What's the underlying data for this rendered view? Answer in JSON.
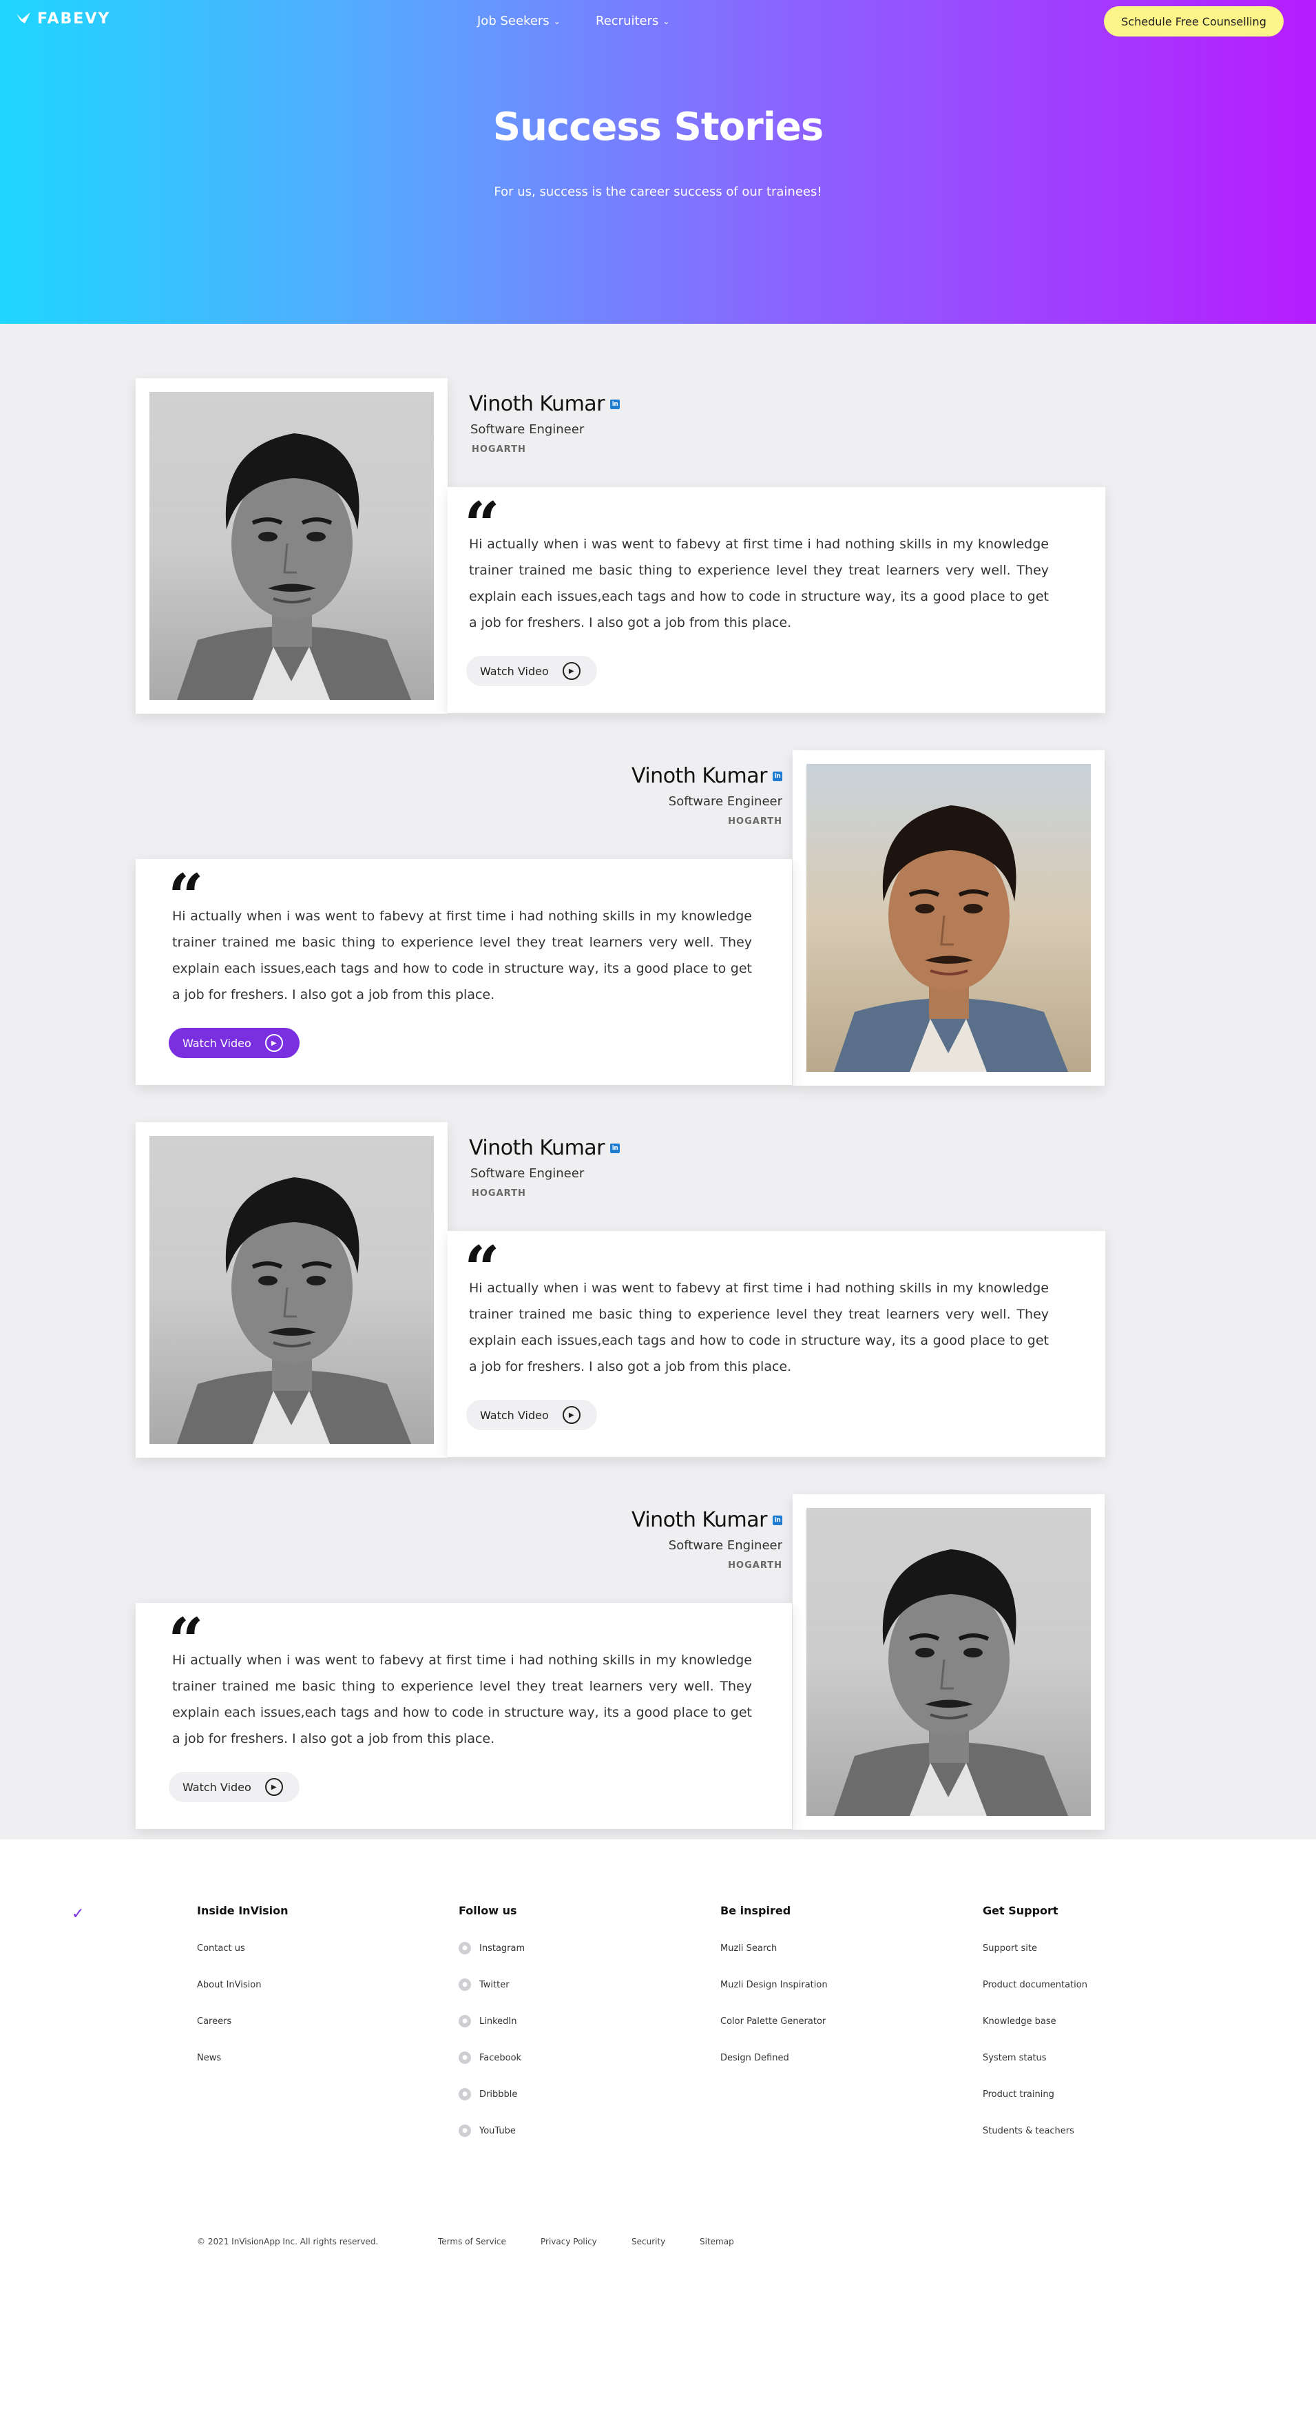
{
  "header": {
    "logo_text": "FABEVY",
    "nav": [
      {
        "label": "Job Seekers"
      },
      {
        "label": "Recruiters"
      }
    ],
    "cta_label": "Schedule Free Counselling"
  },
  "hero": {
    "title": "Success Stories",
    "subtitle": "For us, success is the career success of our trainees!"
  },
  "stories": [
    {
      "name": "Vinoth Kumar",
      "role": "Software Engineer",
      "company": "HOGARTH",
      "quote": "Hi actually when i was went to fabevy at first time i had nothing skills in my knowledge trainer trained me basic thing to experience level they treat learners very well. They explain each issues,each tags and how to code in structure way, its a good place to get a job for freshers. I also got a job from this place.",
      "button_label": "Watch Video",
      "button_active": false,
      "photo_grayscale": true
    },
    {
      "name": "Vinoth Kumar",
      "role": "Software Engineer",
      "company": "HOGARTH",
      "quote": "Hi actually when i was went to fabevy at first time i had nothing skills in my knowledge trainer trained me basic thing to experience level they treat learners very well. They explain each issues,each tags and how to code in structure way, its a good place to get a job for freshers. I also got a job from this place.",
      "button_label": "Watch Video",
      "button_active": true,
      "photo_grayscale": false
    },
    {
      "name": "Vinoth Kumar",
      "role": "Software Engineer",
      "company": "HOGARTH",
      "quote": "Hi actually when i was went to fabevy at first time i had nothing skills in my knowledge trainer trained me basic thing to experience level they treat learners very well. They explain each issues,each tags and how to code in structure way, its a good place to get a job for freshers. I also got a job from this place.",
      "button_label": "Watch Video",
      "button_active": false,
      "photo_grayscale": true
    },
    {
      "name": "Vinoth Kumar",
      "role": "Software Engineer",
      "company": "HOGARTH",
      "quote": "Hi actually when i was went to fabevy at first time i had nothing skills in my knowledge trainer trained me basic thing to experience level they treat learners very well. They explain each issues,each tags and how to code in structure way, its a good place to get a job for freshers. I also got a job from this place.",
      "button_label": "Watch Video",
      "button_active": false,
      "photo_grayscale": true
    }
  ],
  "footer": {
    "columns": [
      {
        "heading": "Inside InVision",
        "links": [
          "Contact us",
          "About InVision",
          "Careers",
          "News"
        ]
      },
      {
        "heading": "Follow us",
        "links": [
          "Instagram",
          "Twitter",
          "LinkedIn",
          "Facebook",
          "Dribbble",
          "YouTube"
        ]
      },
      {
        "heading": "Be inspired",
        "links": [
          "Muzli Search",
          "Muzli Design Inspiration",
          "Color Palette Generator",
          "Design Defined"
        ]
      },
      {
        "heading": "Get Support",
        "links": [
          "Support site",
          "Product documentation",
          "Knowledge base",
          "System status",
          "Product training",
          "Students & teachers"
        ]
      }
    ],
    "copyright": "© 2021 InVisionApp Inc. All rights reserved.",
    "legal_links": [
      "Terms of Service",
      "Privacy Policy",
      "Security",
      "Sitemap"
    ]
  },
  "colors": {
    "accent": "#7a2fe0",
    "cta_bg": "#fdf48a",
    "linkedin": "#1f7dd1"
  },
  "icons": [
    "fabevy-logo-icon",
    "chevron-down-icon",
    "linkedin-icon",
    "quote-icon",
    "play-icon",
    "instagram-icon",
    "twitter-icon",
    "linkedin-icon",
    "facebook-icon",
    "dribbble-icon",
    "youtube-icon"
  ]
}
